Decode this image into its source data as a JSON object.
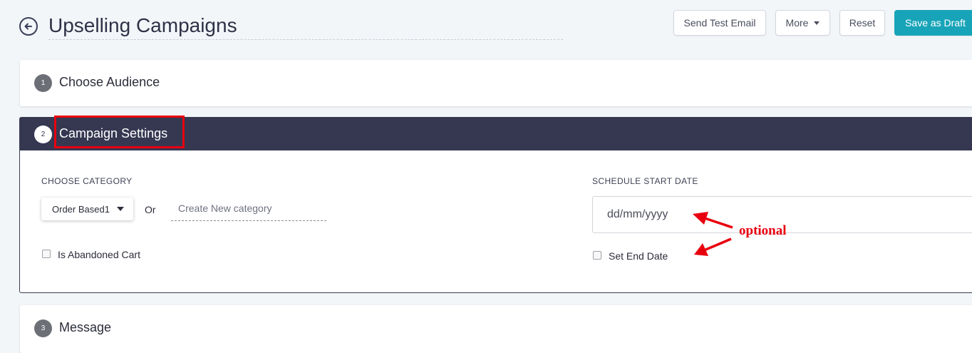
{
  "header": {
    "title": "Upselling Campaigns",
    "buttons": {
      "send_test": "Send Test Email",
      "more": "More",
      "reset": "Reset",
      "save_draft": "Save as Draft"
    }
  },
  "steps": [
    {
      "number": "1",
      "title": "Choose Audience"
    },
    {
      "number": "2",
      "title": "Campaign Settings"
    },
    {
      "number": "3",
      "title": "Message"
    }
  ],
  "settings": {
    "category_label": "CHOOSE CATEGORY",
    "category_selected": "Order Based1",
    "or_text": "Or",
    "new_category_placeholder": "Create New category",
    "abandoned_cart_label": "Is Abandoned Cart",
    "abandoned_cart_checked": false,
    "start_date_label": "SCHEDULE START DATE",
    "start_date_placeholder": "dd/mm/yyyy",
    "end_date_label": "Set End Date",
    "end_date_checked": false
  },
  "annotation": {
    "text": "optional",
    "color": "#e8000f"
  },
  "colors": {
    "accent": "#18a4b8",
    "header_dark": "#363852",
    "highlight": "#e8000f"
  }
}
